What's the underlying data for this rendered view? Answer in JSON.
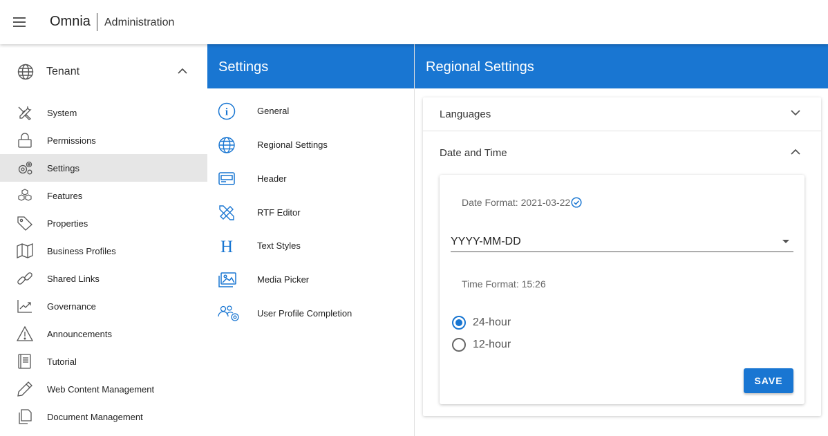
{
  "header": {
    "app_name": "Omnia",
    "section": "Administration"
  },
  "leftnav": {
    "group": {
      "label": "Tenant",
      "icon": "globe-icon"
    },
    "items": [
      {
        "label": "System",
        "icon": "tools-icon"
      },
      {
        "label": "Permissions",
        "icon": "lock-icon"
      },
      {
        "label": "Settings",
        "icon": "gears-icon",
        "active": true
      },
      {
        "label": "Features",
        "icon": "cubes-icon"
      },
      {
        "label": "Properties",
        "icon": "tag-icon"
      },
      {
        "label": "Business Profiles",
        "icon": "map-icon"
      },
      {
        "label": "Shared Links",
        "icon": "link-icon"
      },
      {
        "label": "Governance",
        "icon": "chart-icon"
      },
      {
        "label": "Announcements",
        "icon": "warning-icon"
      },
      {
        "label": "Tutorial",
        "icon": "book-icon"
      },
      {
        "label": "Web Content Management",
        "icon": "pencil-icon"
      },
      {
        "label": "Document Management",
        "icon": "documents-icon"
      }
    ]
  },
  "settings_panel": {
    "title": "Settings",
    "items": [
      {
        "label": "General",
        "icon": "info-icon"
      },
      {
        "label": "Regional Settings",
        "icon": "globe-icon"
      },
      {
        "label": "Header",
        "icon": "header-icon"
      },
      {
        "label": "RTF Editor",
        "icon": "ruler-pencil-icon"
      },
      {
        "label": "Text Styles",
        "icon": "heading-icon"
      },
      {
        "label": "Media Picker",
        "icon": "images-icon"
      },
      {
        "label": "User Profile Completion",
        "icon": "users-gear-icon"
      }
    ]
  },
  "regional": {
    "title": "Regional Settings",
    "languages_label": "Languages",
    "datetime_label": "Date and Time",
    "date_format_label": "Date Format: 2021-03-22",
    "date_format_value": "YYYY-MM-DD",
    "time_format_label": "Time Format: 15:26",
    "time_options": [
      {
        "label": "24-hour",
        "selected": true
      },
      {
        "label": "12-hour",
        "selected": false
      }
    ],
    "save_label": "SAVE"
  },
  "colors": {
    "primary": "#1976d2",
    "active_row": "#e6e6e6"
  }
}
